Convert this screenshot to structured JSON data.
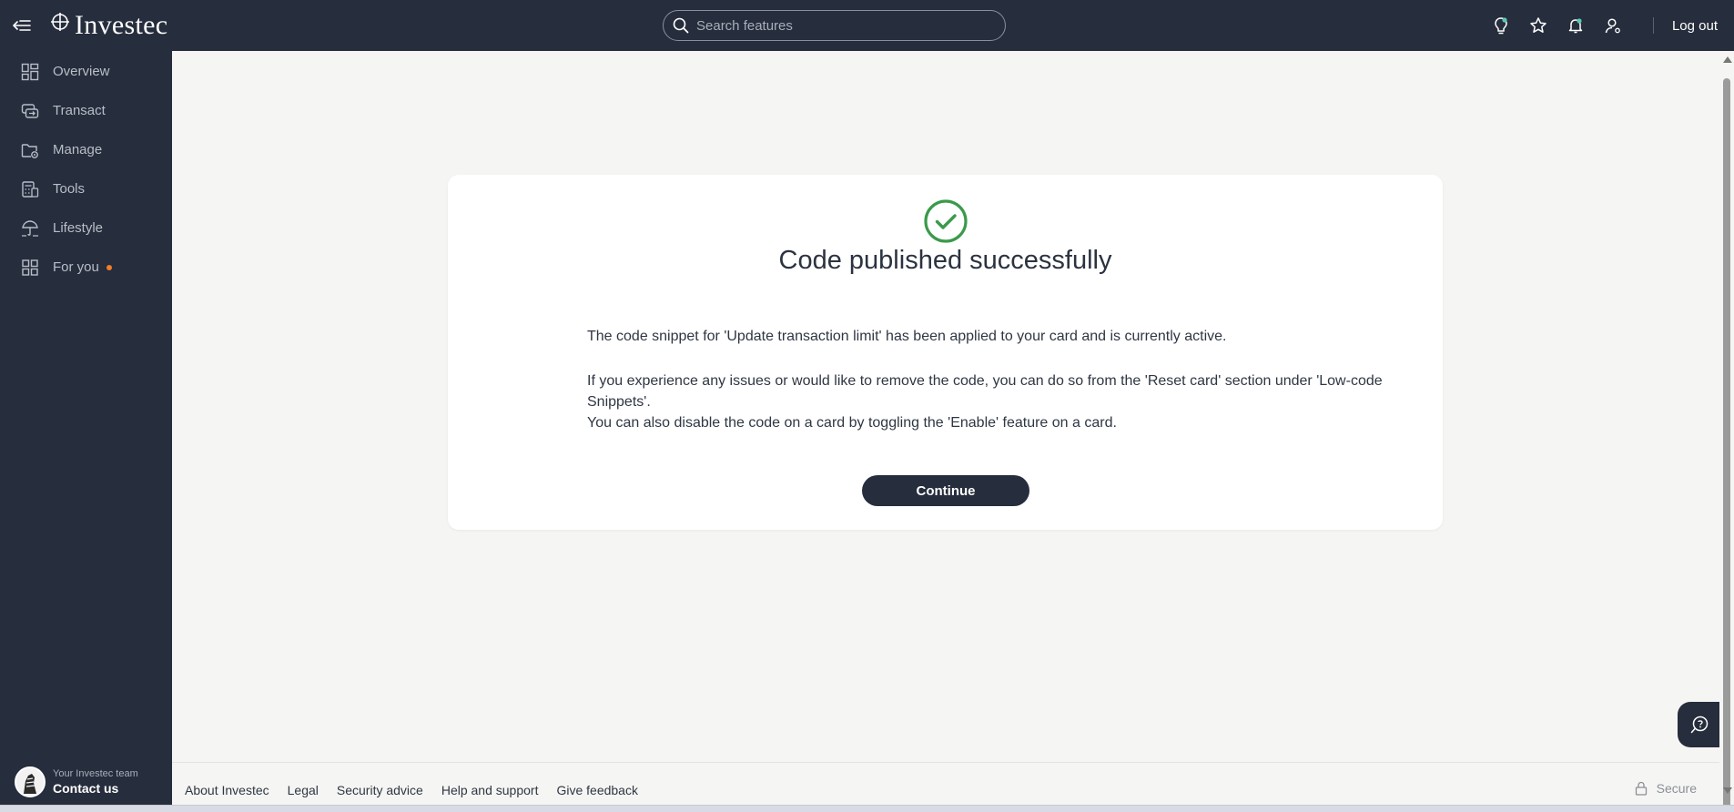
{
  "header": {
    "logo_text": "Investec",
    "search_placeholder": "Search features",
    "logout_label": "Log out",
    "icons": [
      "lightbulb-icon",
      "star-icon",
      "bell-icon",
      "user-settings-icon"
    ]
  },
  "sidebar": {
    "items": [
      {
        "label": "Overview",
        "icon": "grid-icon"
      },
      {
        "label": "Transact",
        "icon": "transfer-icon"
      },
      {
        "label": "Manage",
        "icon": "folder-gear-icon"
      },
      {
        "label": "Tools",
        "icon": "calculator-icon"
      },
      {
        "label": "Lifestyle",
        "icon": "umbrella-icon"
      },
      {
        "label": "For you",
        "icon": "grid-icon",
        "has_badge": true
      }
    ],
    "contact": {
      "subtitle": "Your Investec team",
      "label": "Contact us"
    }
  },
  "card": {
    "title": "Code published successfully",
    "paragraph1": "The code snippet for 'Update transaction limit' has been applied to your card and is currently active.",
    "paragraph2": "If you experience any issues or would like to remove the code, you can do so from the 'Reset card' section under 'Low-code Snippets'.",
    "paragraph3": "You can also disable the code on a card by toggling the 'Enable' feature on a card.",
    "button_label": "Continue"
  },
  "footer": {
    "links": [
      "About Investec",
      "Legal",
      "Security advice",
      "Help and support",
      "Give feedback"
    ],
    "secure_label": "Secure"
  },
  "colors": {
    "nav_bg": "#262d3c",
    "page_bg": "#f5f5f3",
    "success": "#3a9a4a",
    "badge": "#f07d2a"
  }
}
